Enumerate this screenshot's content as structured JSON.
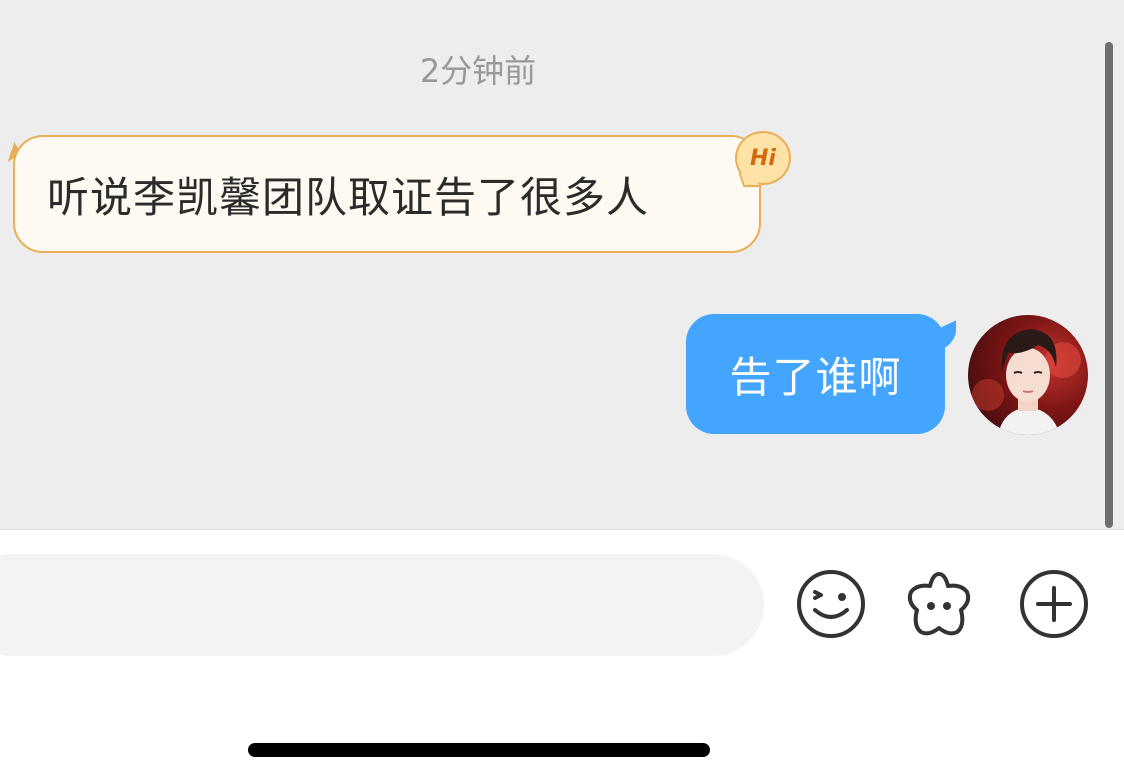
{
  "chat": {
    "timestamp": "2分钟前",
    "messages": [
      {
        "sender": "other",
        "text": "听说李凯馨团队取证告了很多人",
        "badge": "Hi"
      },
      {
        "sender": "self",
        "text": "告了谁啊"
      }
    ]
  },
  "input": {
    "value": "",
    "placeholder": ""
  },
  "toolbar": {
    "icons": [
      "emoji-icon",
      "sticker-icon",
      "plus-icon"
    ]
  },
  "colors": {
    "chat_background": "#ededed",
    "incoming_bubble": "#fffaf1",
    "incoming_border": "#e8ae58",
    "outgoing_bubble": "#44a5ff",
    "icon_stroke": "#333333"
  }
}
